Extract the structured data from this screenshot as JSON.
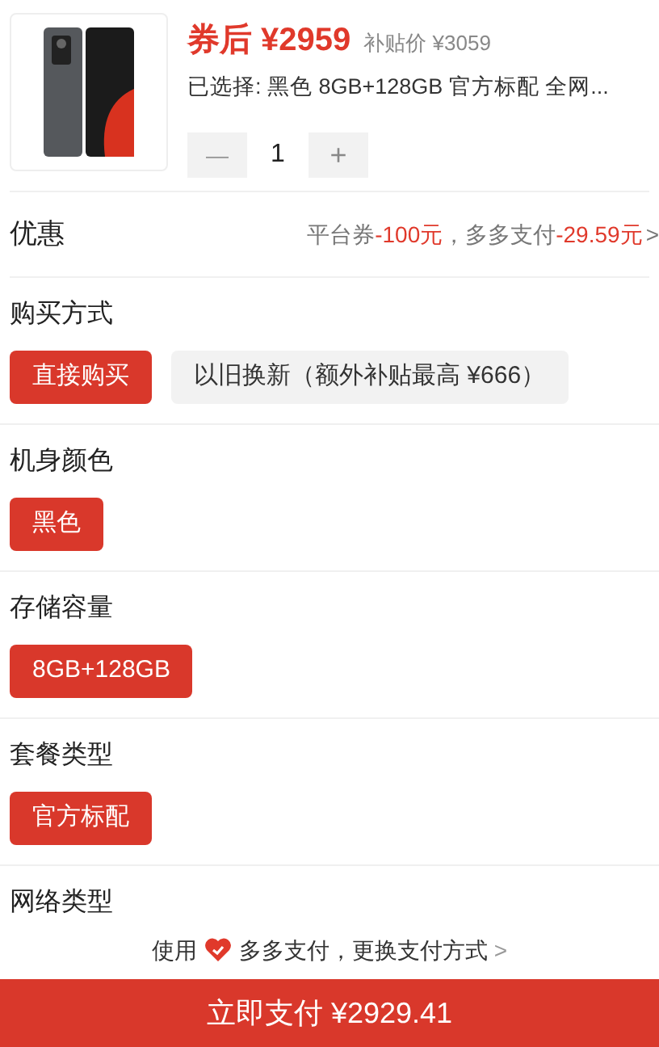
{
  "product": {
    "price_label": "券后",
    "price": "¥2959",
    "subsidy_label": "补贴价",
    "subsidy_price": "¥3059",
    "selected_text": "已选择: 黑色 8GB+128GB 官方标配 全网...",
    "quantity": "1",
    "minus": "—",
    "plus": "+",
    "minus_disabled": true
  },
  "discount": {
    "label": "优惠",
    "parts": [
      {
        "text": "平台券",
        "highlight": false
      },
      {
        "text": "-100元",
        "highlight": true
      },
      {
        "text": "，多多支付",
        "highlight": false
      },
      {
        "text": "-29.59元",
        "highlight": true
      }
    ],
    "chevron": ">"
  },
  "sections": [
    {
      "title": "购买方式",
      "options": [
        {
          "label": "直接购买",
          "selected": true
        },
        {
          "label": "以旧换新（额外补贴最高 ¥666）",
          "selected": false
        }
      ]
    },
    {
      "title": "机身颜色",
      "options": [
        {
          "label": "黑色",
          "selected": true
        }
      ]
    },
    {
      "title": "存储容量",
      "options": [
        {
          "label": "8GB+128GB",
          "selected": true
        }
      ]
    },
    {
      "title": "套餐类型",
      "options": [
        {
          "label": "官方标配",
          "selected": true
        }
      ]
    },
    {
      "title": "网络类型"
    }
  ],
  "payment_bar": {
    "prefix": "使用",
    "method": "多多支付，更换支付方式",
    "chevron": ">"
  },
  "pay_button": "立即支付 ¥2929.41"
}
